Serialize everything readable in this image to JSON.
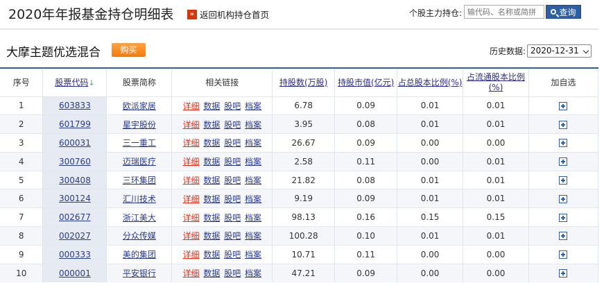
{
  "header": {
    "title": "2020年年报基金持仓明细表",
    "back_icon": "»",
    "back_link": "返回机构持仓首页",
    "search_label": "个股主力持仓:",
    "search_placeholder": "输代码、名称或简拼",
    "search_button": "查询"
  },
  "fund": {
    "name": "大摩主题优选混合",
    "buy_button": "购买",
    "history_label": "历史数据:",
    "history_selected": "2020-12-31"
  },
  "table": {
    "headers": {
      "seq": "序号",
      "code": "股票代码",
      "name": "股票简称",
      "links": "相关链接",
      "shares": "持股数(万股)",
      "value": "持股市值(亿元)",
      "pct_total": "占总股本比例(%)",
      "pct_float": "占流通股本比例(%)",
      "add": "加自选"
    },
    "link_labels": {
      "detail": "详细",
      "data": "数据",
      "guba": "股吧",
      "archive": "档案"
    },
    "rows": [
      {
        "seq": "1",
        "code": "603833",
        "name": "欧派家居",
        "shares": "6.78",
        "value": "0.09",
        "pct_total": "0.01",
        "pct_float": "0.01"
      },
      {
        "seq": "2",
        "code": "601799",
        "name": "星宇股份",
        "shares": "3.95",
        "value": "0.08",
        "pct_total": "0.01",
        "pct_float": "0.01"
      },
      {
        "seq": "3",
        "code": "600031",
        "name": "三一重工",
        "shares": "26.67",
        "value": "0.09",
        "pct_total": "0.00",
        "pct_float": "0.00"
      },
      {
        "seq": "4",
        "code": "300760",
        "name": "迈瑞医疗",
        "shares": "2.58",
        "value": "0.11",
        "pct_total": "0.00",
        "pct_float": "0.01"
      },
      {
        "seq": "5",
        "code": "300408",
        "name": "三环集团",
        "shares": "21.82",
        "value": "0.08",
        "pct_total": "0.01",
        "pct_float": "0.01"
      },
      {
        "seq": "6",
        "code": "300124",
        "name": "汇川技术",
        "shares": "9.19",
        "value": "0.09",
        "pct_total": "0.01",
        "pct_float": "0.01"
      },
      {
        "seq": "7",
        "code": "002677",
        "name": "浙江美大",
        "shares": "98.13",
        "value": "0.16",
        "pct_total": "0.15",
        "pct_float": "0.15"
      },
      {
        "seq": "8",
        "code": "002027",
        "name": "分众传媒",
        "shares": "100.28",
        "value": "0.10",
        "pct_total": "0.01",
        "pct_float": "0.01"
      },
      {
        "seq": "9",
        "code": "000333",
        "name": "美的集团",
        "shares": "10.71",
        "value": "0.11",
        "pct_total": "0.00",
        "pct_float": "0.00"
      },
      {
        "seq": "10",
        "code": "000001",
        "name": "平安银行",
        "shares": "47.21",
        "value": "0.09",
        "pct_total": "0.00",
        "pct_float": "0.00"
      }
    ]
  }
}
